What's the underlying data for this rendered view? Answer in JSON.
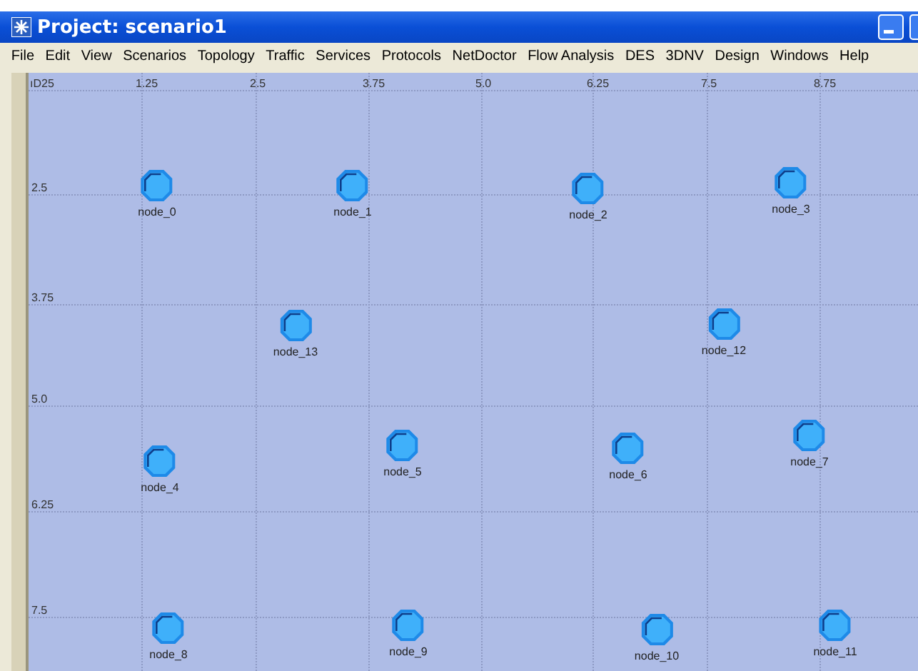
{
  "window": {
    "title": "Project: scenario1"
  },
  "menu": [
    "File",
    "Edit",
    "View",
    "Scenarios",
    "Topology",
    "Traffic",
    "Services",
    "Protocols",
    "NetDoctor",
    "Flow Analysis",
    "DES",
    "3DNV",
    "Design",
    "Windows",
    "Help"
  ],
  "canvas": {
    "corner_label": "ıD25",
    "x_labels": [
      "1.25",
      "2.5",
      "3.75",
      "5.0",
      "6.25",
      "7.5",
      "8.75"
    ],
    "y_labels": [
      "2.5",
      "3.75",
      "5.0",
      "6.25",
      "7.5"
    ],
    "nodes": [
      {
        "label": "node_0"
      },
      {
        "label": "node_1"
      },
      {
        "label": "node_2"
      },
      {
        "label": "node_3"
      },
      {
        "label": "node_13"
      },
      {
        "label": "node_12"
      },
      {
        "label": "node_5"
      },
      {
        "label": "node_6"
      },
      {
        "label": "node_7"
      },
      {
        "label": "node_4"
      },
      {
        "label": "node_8"
      },
      {
        "label": "node_9"
      },
      {
        "label": "node_10"
      },
      {
        "label": "node_11"
      }
    ]
  }
}
